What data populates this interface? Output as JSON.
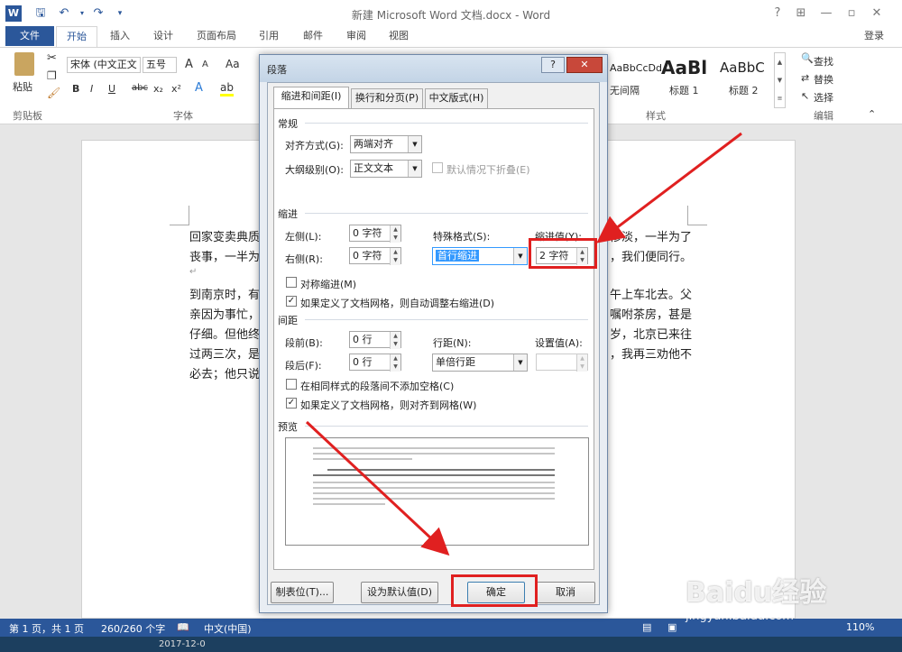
{
  "window": {
    "title": "新建 Microsoft Word 文档.docx - Word",
    "help": "?",
    "restore": "⊞",
    "minimize": "—",
    "close": "✕",
    "login": "登录"
  },
  "tabs": [
    "文件",
    "开始",
    "插入",
    "设计",
    "页面布局",
    "引用",
    "邮件",
    "审阅",
    "视图"
  ],
  "ribbon": {
    "paste": "粘贴",
    "clipboard_label": "剪贴板",
    "font_name": "宋体 (中文正文",
    "font_size": "五号",
    "font_label": "字体",
    "bold": "B",
    "italic": "I",
    "underline": "U",
    "strike": "abc",
    "sub": "x₂",
    "sup": "x²",
    "grow": "A",
    "shrink": "A",
    "case": "Aa",
    "styles": [
      {
        "sample": "AaBbCcDd",
        "name": "无间隔"
      },
      {
        "sample": "AaBl",
        "name": "标题 1"
      },
      {
        "sample": "AaBbC",
        "name": "标题 2"
      }
    ],
    "styles_label": "样式",
    "find": "查找",
    "replace": "替换",
    "select": "选择",
    "edit_label": "编辑"
  },
  "document": {
    "lines": [
      "回家变卖典质，父亲还了亏空；又借钱办了丧事。这些日子，家中光景很是惨淡，一半为了",
      "丧事，一半为了父亲赋闲。丧事完毕，父亲要到南京谋事，我也要回北京念书，我们便同行。",
      "到南京时，有朋友约去游逛，勾留了一日；第二日上午便须渡江到浦口，下午上车北去。父",
      "亲因为事忙，本已说定不送我，叫旅馆里一个熟识的茶房陪我同去。他再三嘱咐茶房，甚是",
      "仔细。但他终于不放心，怕茶房不妥帖；颇踌躇了一会。其实我那年已二十岁，北京已来往",
      "过两三次，是没有什么要紧的了。他踌躇了一会，终于决定还是自己送我去。我再三劝他不",
      "必去；他只说，不要紧，他们去不好！"
    ],
    "left_visible": [
      "回家变卖典质",
      "丧事，一半为",
      "到南京时，有",
      "亲因为事忙，",
      "仔细。但他终",
      "过两三次，是",
      "必去；他只说"
    ],
    "right_visible": [
      "惨淡，一半为了",
      "，我们便同行。",
      "午上车北去。父",
      "嘱咐茶房，甚是",
      "岁，北京已来往",
      "，我再三劝他不",
      ""
    ],
    "para_mark": "↵"
  },
  "dialog": {
    "title": "段落",
    "tabs": [
      "缩进和间距(I)",
      "换行和分页(P)",
      "中文版式(H)"
    ],
    "general_label": "常规",
    "alignment_label": "对齐方式(G):",
    "alignment_value": "两端对齐",
    "outline_label": "大纲级别(O):",
    "outline_value": "正文文本",
    "collapse_label": "默认情况下折叠(E)",
    "indent_label": "缩进",
    "left_label": "左侧(L):",
    "left_value": "0 字符",
    "right_label": "右侧(R):",
    "right_value": "0 字符",
    "special_label": "特殊格式(S):",
    "special_value": "首行缩进",
    "indent_by_label": "缩进值(Y):",
    "indent_by_value": "2 字符",
    "mirror_label": "对称缩进(M)",
    "auto_adjust_label": "如果定义了文档网格，则自动调整右缩进(D)",
    "spacing_label": "间距",
    "before_label": "段前(B):",
    "before_value": "0 行",
    "after_label": "段后(F):",
    "after_value": "0 行",
    "line_spacing_label": "行距(N):",
    "line_spacing_value": "单倍行距",
    "at_label": "设置值(A):",
    "at_value": "",
    "no_space_label": "在相同样式的段落间不添加空格(C)",
    "snap_grid_label": "如果定义了文档网格，则对齐到网格(W)",
    "preview_label": "预览",
    "tabs_button": "制表位(T)...",
    "default_button": "设为默认值(D)",
    "ok_button": "确定",
    "cancel_button": "取消"
  },
  "status": {
    "page": "第 1 页，共 1 页",
    "words": "260/260 个字",
    "lang": "中文(中国)",
    "zoom": "110%",
    "taskbar_time": "2017-12-0"
  },
  "watermark": {
    "brand": "Baidu经验",
    "url": "jingyan.baidu.com"
  },
  "colors": {
    "accent": "#2b579a",
    "highlight": "#e02020"
  }
}
